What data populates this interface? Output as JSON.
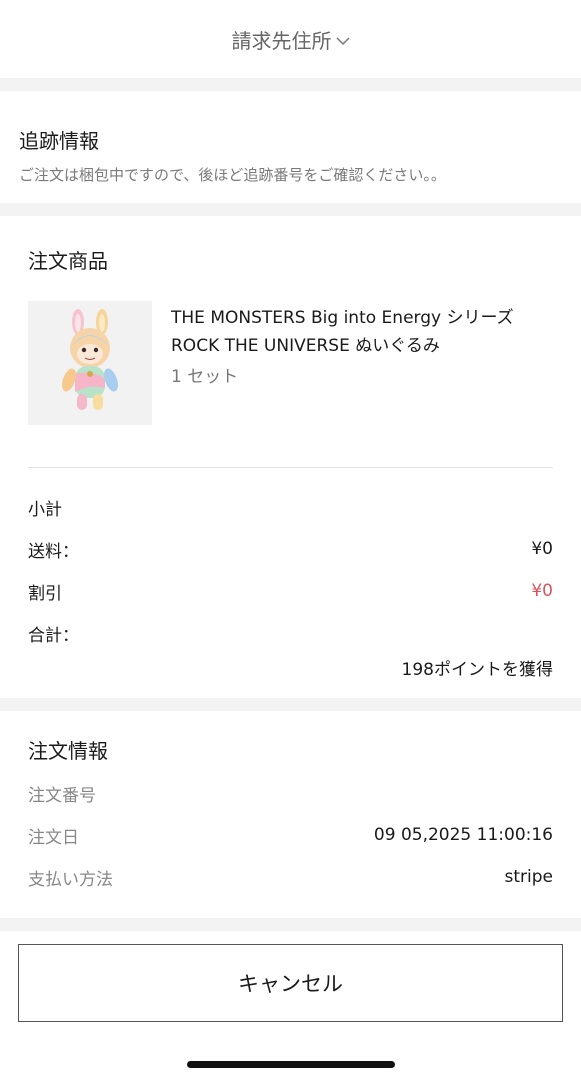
{
  "header": {
    "billing_address_label": "請求先住所",
    "chevron_icon": "chevron-down-icon"
  },
  "tracking": {
    "title": "追跡情報",
    "description": "ご注文は梱包中ですので、後ほど追跡番号をご確認ください。。"
  },
  "products": {
    "title": "注文商品",
    "items": [
      {
        "name": "THE MONSTERS Big into Energy シリーズ ROCK THE UNIVERSE ぬいぐるみ",
        "quantity": "1 セット",
        "image_icon": "plush-figure-image"
      }
    ]
  },
  "summary": {
    "subtotal_label": "小計",
    "subtotal_value": "",
    "shipping_label": "送料：",
    "shipping_value": "¥0",
    "discount_label": "割引",
    "discount_value": "¥0",
    "total_label": "合計：",
    "total_value": "",
    "points_text": "198ポイントを獲得",
    "discount_color": "#d9535e"
  },
  "order_info": {
    "title": "注文情報",
    "order_number_label": "注文番号",
    "order_number_value": "",
    "order_date_label": "注文日",
    "order_date_value": "09 05,2025 11:00:16",
    "payment_method_label": "支払い方法",
    "payment_method_value": "stripe"
  },
  "actions": {
    "cancel_label": "キャンセル"
  }
}
